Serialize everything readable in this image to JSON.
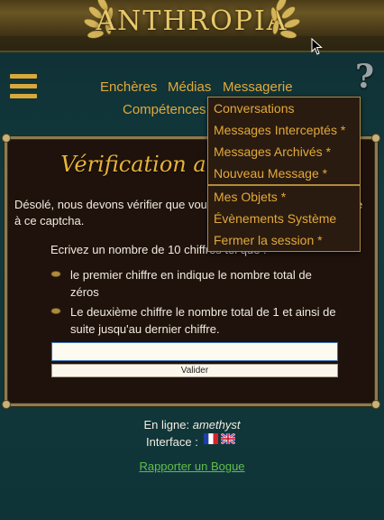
{
  "header": {
    "brand": "ANTHROPIA"
  },
  "nav": {
    "items": [
      {
        "label": "Enchères"
      },
      {
        "label": "Médias"
      },
      {
        "label": "Messagerie"
      },
      {
        "label": "Compétences"
      }
    ]
  },
  "help": {
    "label": "?"
  },
  "panel": {
    "title": "Vérification anti-zombie",
    "intro": "Désolé, nous devons vérifier que vous n'êtes pas un zombie, grâce à ce captcha.",
    "instruction": "Ecrivez un nombre de 10 chiffres tel que :",
    "rules": [
      "le premier chiffre en indique le nombre total de zéros",
      "Le deuxième chiffre le nombre total de 1 et ainsi de suite jusqu'au dernier chiffre."
    ],
    "input": {
      "value": "",
      "placeholder": ""
    },
    "validate_label": "Valider"
  },
  "dropdown": {
    "group1": [
      "Conversations",
      "Messages Interceptés *",
      "Messages Archivés *",
      "Nouveau Message *"
    ],
    "group2": [
      "Mes Objets *",
      "Évènements Système",
      "Fermer la session *"
    ]
  },
  "footer": {
    "online_label": "En ligne:",
    "online_user": "amethyst",
    "interface_label": "Interface :",
    "report_link": "Rapporter un Bogue"
  },
  "colors": {
    "accent": "#e2a93a",
    "background": "#123a3e",
    "panel": "#1f120c",
    "link_green": "#5fbf4a"
  }
}
